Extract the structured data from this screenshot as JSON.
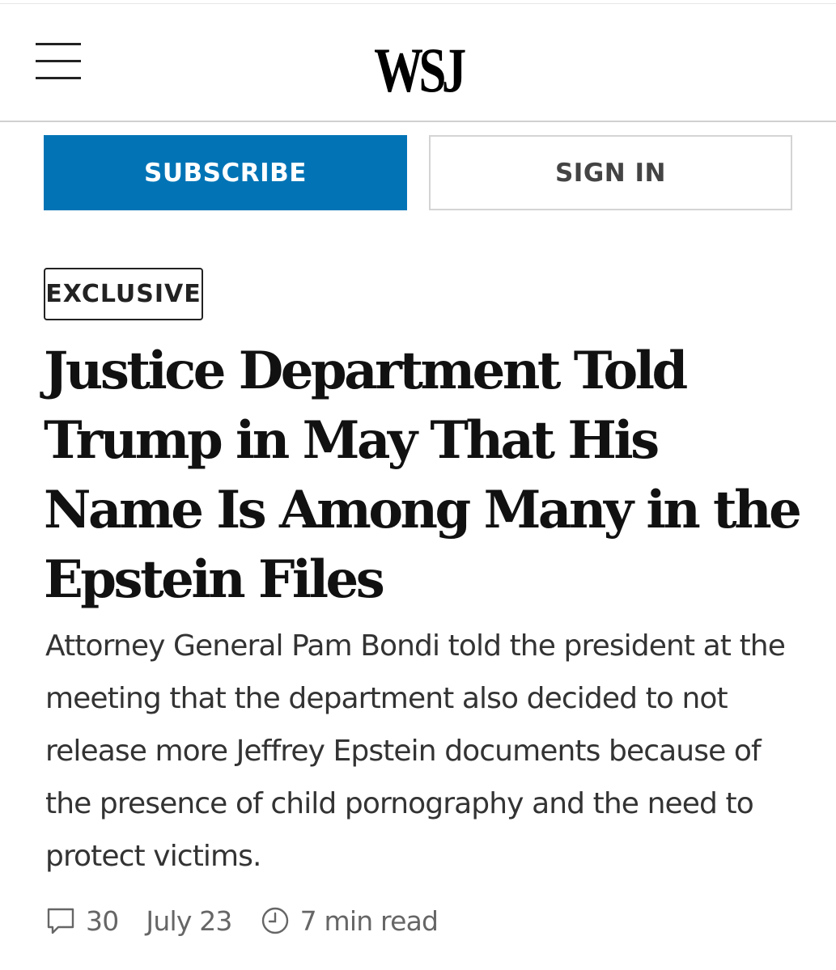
{
  "header": {
    "logo_text": "WSJ",
    "menu_icon": "hamburger-menu-icon"
  },
  "account": {
    "subscribe_label": "SUBSCRIBE",
    "signin_label": "SIGN IN"
  },
  "article": {
    "badge": "EXCLUSIVE",
    "headline": "Justice Department Told Trump in May That His Name Is Among Many in the Epstein Files",
    "dek": "Attorney General Pam Bondi told the president at the meeting that the department also decided to not release more Jeffrey Epstein documents because of the presence of child pornography and the need to protect victims.",
    "meta": {
      "comment_icon": "comment-bubble-icon",
      "comment_count": "30",
      "date": "July 23",
      "clock_icon": "clock-icon",
      "read_time": "7 min read"
    }
  },
  "colors": {
    "brand_blue": "#0274b6",
    "text_dark": "#111111",
    "text_muted": "#666666"
  }
}
